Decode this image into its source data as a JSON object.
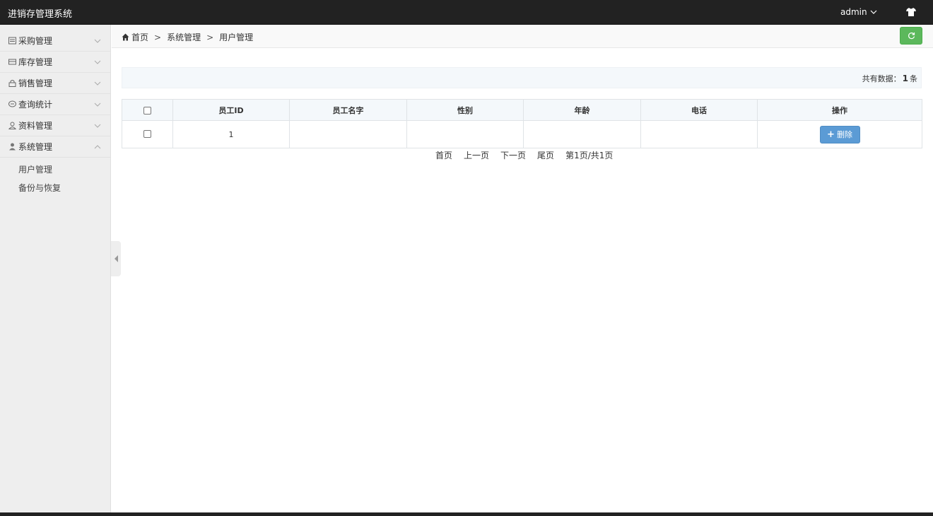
{
  "header": {
    "app_title": "进销存管理系统",
    "user": "admin",
    "skin_icon": "tshirt-icon"
  },
  "sidebar": {
    "items": [
      {
        "label": "采购管理",
        "icon": "purchase-icon",
        "expanded": false
      },
      {
        "label": "库存管理",
        "icon": "stock-icon",
        "expanded": false
      },
      {
        "label": "销售管理",
        "icon": "lock-icon",
        "expanded": false
      },
      {
        "label": "查询统计",
        "icon": "chat-icon",
        "expanded": false
      },
      {
        "label": "资料管理",
        "icon": "user-outline-icon",
        "expanded": false
      },
      {
        "label": "系统管理",
        "icon": "user-icon",
        "expanded": true
      }
    ],
    "submenu": [
      {
        "label": "用户管理"
      },
      {
        "label": "备份与恢复"
      }
    ]
  },
  "breadcrumb": {
    "home": "首页",
    "separator": ">",
    "level1": "系统管理",
    "level2": "用户管理"
  },
  "summary": {
    "label": "共有数据：",
    "count": "1",
    "unit": "条"
  },
  "table": {
    "columns": [
      "员工ID",
      "员工名字",
      "性别",
      "年龄",
      "电话",
      "操作"
    ],
    "rows": [
      {
        "id": "1",
        "name": "",
        "gender": "",
        "age": "",
        "phone": "",
        "action": "删除"
      }
    ]
  },
  "pager": {
    "first": "首页",
    "prev": "上一页",
    "next": "下一页",
    "last": "尾页",
    "info": "第1页/共1页"
  },
  "colors": {
    "topbar": "#222222",
    "refresh": "#5cb85c",
    "delete": "#5b9bd5"
  }
}
